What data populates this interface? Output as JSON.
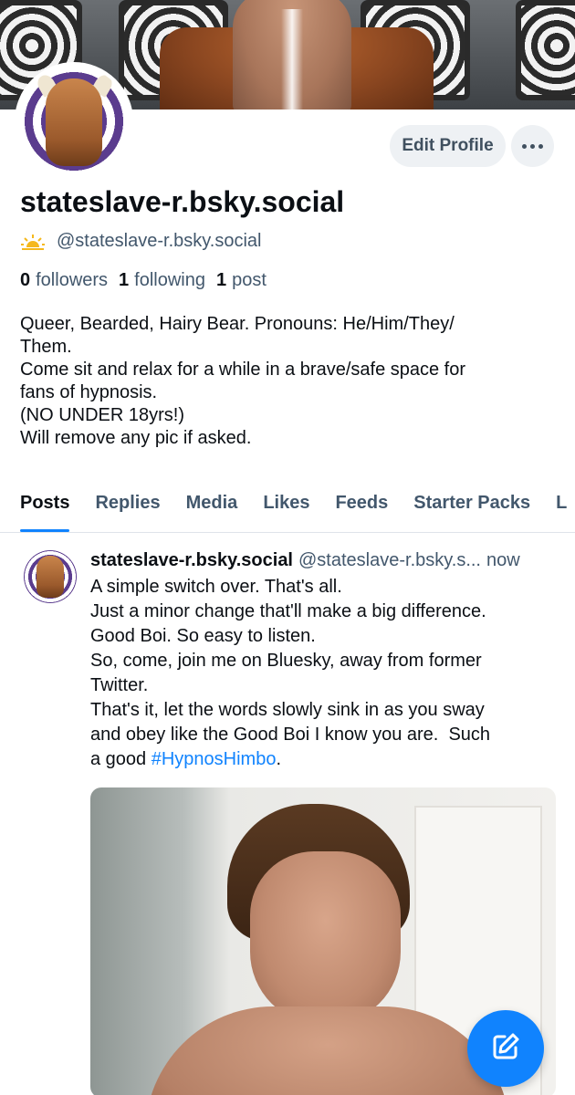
{
  "profile": {
    "display_name": "stateslave-r.bsky.social",
    "handle": "@stateslave-r.bsky.social",
    "edit_label": "Edit Profile",
    "stats": {
      "followers_count": "0",
      "followers_label": "followers",
      "following_count": "1",
      "following_label": "following",
      "posts_count": "1",
      "posts_label": "post"
    },
    "bio": [
      "Queer, Bearded, Hairy Bear. Pronouns: He/Him/They/",
      "Them.",
      "Come sit and relax for a while in a brave/safe space for",
      "fans of hypnosis.",
      "(NO UNDER 18yrs!)",
      "Will remove any pic if asked."
    ]
  },
  "tabs": [
    {
      "label": "Posts",
      "active": true
    },
    {
      "label": "Replies",
      "active": false
    },
    {
      "label": "Media",
      "active": false
    },
    {
      "label": "Likes",
      "active": false
    },
    {
      "label": "Feeds",
      "active": false
    },
    {
      "label": "Starter Packs",
      "active": false
    },
    {
      "label": "L",
      "active": false
    }
  ],
  "post": {
    "author": "stateslave-r.bsky.social",
    "handle": "@stateslave-r.bsky.s...",
    "time": "now",
    "lines": [
      "A simple switch over. That's all.",
      "Just a minor change that'll make a big difference.",
      "Good Boi. So easy to listen.",
      "So, come, join me on Bluesky, away from former",
      "Twitter.",
      "That's it, let the words slowly sink in as you sway",
      "and obey like the Good Boi I know you are.  Such"
    ],
    "last_line_prefix": "a good ",
    "hashtag": "#HypnosHimbo",
    "last_line_suffix": "."
  },
  "icons": {
    "more": "more-horizontal-icon",
    "handle_badge": "sunrise-icon",
    "compose": "compose-pencil-icon"
  },
  "colors": {
    "accent": "#1083fe",
    "muted_text": "#42576c",
    "button_bg": "#eef1f4"
  }
}
